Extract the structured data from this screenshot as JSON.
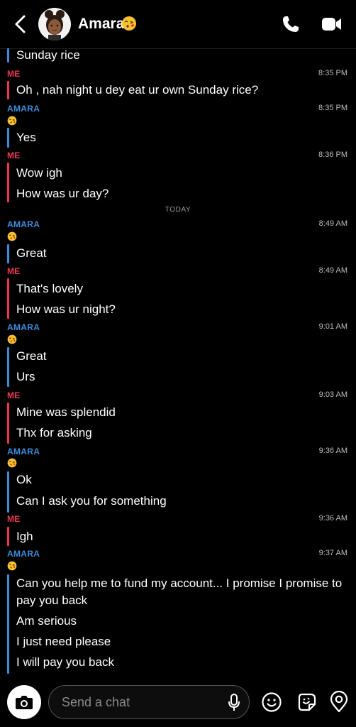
{
  "header": {
    "title": "Amara",
    "title_emoji": "kiss-face-emoji"
  },
  "day_separator": "TODAY",
  "messages": [
    {
      "text": "Sunday rice"
    },
    {
      "sender": "ME",
      "time": "8:35 PM",
      "text": "Oh , nah night u dey eat ur own Sunday rice?"
    },
    {
      "sender": "AMARA",
      "time": "8:35 PM",
      "text": "Yes"
    },
    {
      "sender": "ME",
      "time": "8:36 PM",
      "lines": [
        "Wow  igh",
        "How was ur day?"
      ]
    },
    {
      "sender": "AMARA",
      "time": "8:49 AM",
      "text": "Great"
    },
    {
      "sender": "ME",
      "time": "8:49 AM",
      "lines": [
        "That's lovely",
        "How was ur night?"
      ]
    },
    {
      "sender": "AMARA",
      "time": "9:01 AM",
      "lines": [
        "Great",
        "Urs"
      ]
    },
    {
      "sender": "ME",
      "time": "9:03 AM",
      "lines": [
        "Mine was splendid",
        "Thx for asking"
      ]
    },
    {
      "sender": "AMARA",
      "time": "9:36 AM",
      "lines": [
        "Ok",
        "Can I ask you for something"
      ]
    },
    {
      "sender": "ME",
      "time": "9:36 AM",
      "text": "Igh"
    },
    {
      "sender": "AMARA",
      "time": "9:37 AM",
      "lines": [
        "Can you help me to fund my account... I promise I promise to pay you back",
        "Am serious",
        "I just need please",
        "I will pay you back"
      ]
    }
  ],
  "composer": {
    "placeholder": "Send a chat"
  },
  "colors": {
    "me": "#f2344f",
    "amara": "#3a8dde",
    "background": "#000000"
  }
}
